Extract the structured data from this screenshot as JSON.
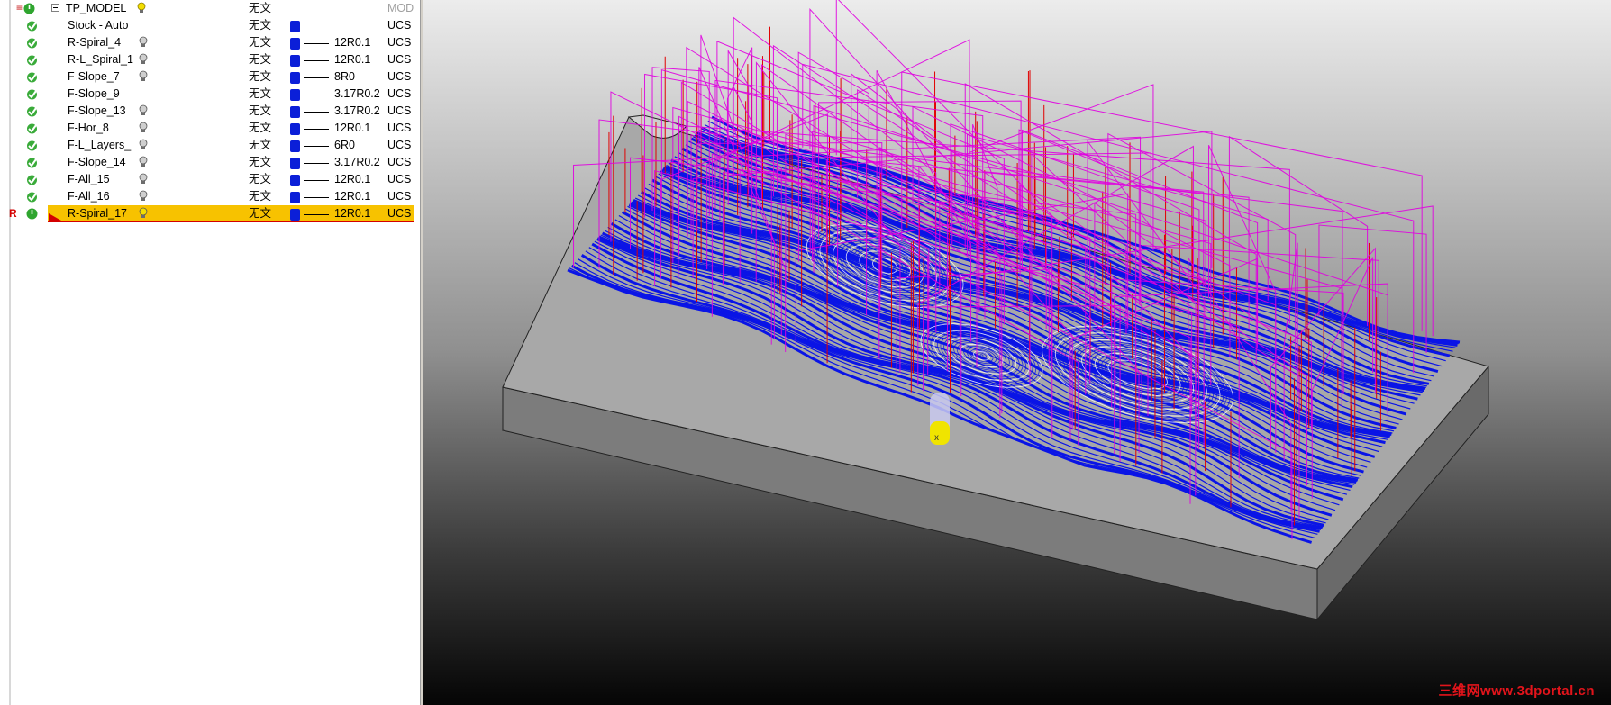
{
  "tree": {
    "header": {
      "name": "TP_MODEL",
      "file": "无文",
      "cs": "MOD"
    },
    "rows": [
      {
        "name": "Stock - Auto",
        "file": "无文",
        "tool": "",
        "cs": "UCS",
        "bulb": false,
        "swatch": true,
        "selected": false,
        "status": "done"
      },
      {
        "name": "R-Spiral_4",
        "file": "无文",
        "tool": "12R0.1",
        "cs": "UCS",
        "bulb": true,
        "swatch": true,
        "selected": false,
        "status": "done"
      },
      {
        "name": "R-L_Spiral_1",
        "file": "无文",
        "tool": "12R0.1",
        "cs": "UCS",
        "bulb": true,
        "swatch": true,
        "selected": false,
        "status": "done"
      },
      {
        "name": "F-Slope_7",
        "file": "无文",
        "tool": "8R0",
        "cs": "UCS",
        "bulb": true,
        "swatch": true,
        "selected": false,
        "status": "done"
      },
      {
        "name": "F-Slope_9",
        "file": "无文",
        "tool": "3.17R0.2",
        "cs": "UCS",
        "bulb": false,
        "swatch": true,
        "selected": false,
        "status": "done-solid"
      },
      {
        "name": "F-Slope_13",
        "file": "无文",
        "tool": "3.17R0.2",
        "cs": "UCS",
        "bulb": true,
        "swatch": true,
        "selected": false,
        "status": "done"
      },
      {
        "name": "F-Hor_8",
        "file": "无文",
        "tool": "12R0.1",
        "cs": "UCS",
        "bulb": true,
        "swatch": true,
        "selected": false,
        "status": "done"
      },
      {
        "name": "F-L_Layers_",
        "file": "无文",
        "tool": "6R0",
        "cs": "UCS",
        "bulb": true,
        "swatch": true,
        "selected": false,
        "status": "done"
      },
      {
        "name": "F-Slope_14",
        "file": "无文",
        "tool": "3.17R0.2",
        "cs": "UCS",
        "bulb": true,
        "swatch": true,
        "selected": false,
        "status": "done"
      },
      {
        "name": "F-All_15",
        "file": "无文",
        "tool": "12R0.1",
        "cs": "UCS",
        "bulb": true,
        "swatch": true,
        "selected": false,
        "status": "done"
      },
      {
        "name": "F-All_16",
        "file": "无文",
        "tool": "12R0.1",
        "cs": "UCS",
        "bulb": true,
        "swatch": true,
        "selected": false,
        "status": "done"
      },
      {
        "name": "R-Spiral_17",
        "file": "无文",
        "tool": "12R0.1",
        "cs": "UCS",
        "bulb": true,
        "swatch": true,
        "selected": true,
        "status": "active"
      }
    ],
    "active_marker": "R"
  },
  "viewport": {
    "watermark": "三维网www.3dportal.cn",
    "colors": {
      "stock": "#8a8a8a",
      "toolpath": "#0a14e6",
      "rapid": "#e000e0",
      "plunge": "#e00000",
      "tool": "#e8e000"
    }
  },
  "colors": {
    "selection": "#f7c200",
    "selection_border": "#d40000",
    "swatch": "#0b1fd8"
  }
}
